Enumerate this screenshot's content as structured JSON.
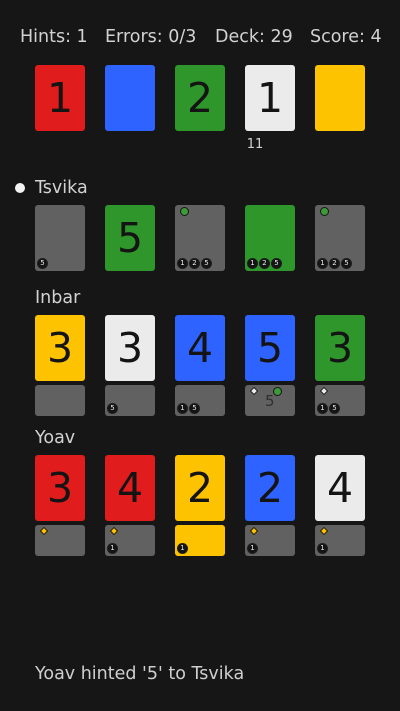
{
  "status": {
    "hints": "Hints: 1",
    "errors": "Errors: 0/3",
    "deck": "Deck: 29",
    "score": "Score: 4"
  },
  "colors": {
    "red": "#e01c1c",
    "blue": "#2f63ff",
    "green": "#2f962b",
    "white": "#ebebeb",
    "yellow": "#fdc200",
    "hint_bg": "#616161"
  },
  "fireworks": [
    {
      "color": "red",
      "value": "1"
    },
    {
      "color": "blue",
      "value": ""
    },
    {
      "color": "green",
      "value": "2"
    },
    {
      "color": "white",
      "value": "1"
    },
    {
      "color": "yellow",
      "value": ""
    }
  ],
  "fireworks_count": "11",
  "players": [
    {
      "name": "Tsvika",
      "active": true,
      "cards": [
        {
          "face": null,
          "color": null,
          "value": "",
          "hint_dots": [],
          "numbers": [
            "5"
          ],
          "center": ""
        },
        {
          "face": "visible",
          "color": "green",
          "value": "5",
          "hint_dots": [],
          "numbers": [],
          "center": ""
        },
        {
          "face": null,
          "color": null,
          "value": "",
          "hint_dots": [
            "green"
          ],
          "numbers": [
            "1",
            "2",
            "5"
          ],
          "center": ""
        },
        {
          "face": "tinted",
          "color": "green",
          "value": "",
          "hint_dots": [],
          "numbers": [
            "1",
            "2",
            "5"
          ],
          "center": ""
        },
        {
          "face": null,
          "color": null,
          "value": "",
          "hint_dots": [
            "green"
          ],
          "numbers": [
            "1",
            "2",
            "5"
          ],
          "center": ""
        }
      ]
    },
    {
      "name": "Inbar",
      "active": false,
      "cards": [
        {
          "color": "yellow",
          "value": "3",
          "hint_dots": [],
          "numbers": [],
          "center": ""
        },
        {
          "color": "white",
          "value": "3",
          "hint_dots": [],
          "numbers": [
            "5"
          ],
          "center": ""
        },
        {
          "color": "blue",
          "value": "4",
          "hint_dots": [],
          "numbers": [
            "1",
            "5"
          ],
          "center": ""
        },
        {
          "color": "blue",
          "value": "5",
          "hint_dots": [
            "white",
            "green"
          ],
          "numbers": [],
          "center": "5"
        },
        {
          "color": "green",
          "value": "3",
          "hint_dots": [
            "white"
          ],
          "numbers": [
            "1",
            "5"
          ],
          "center": ""
        }
      ]
    },
    {
      "name": "Yoav",
      "active": false,
      "cards": [
        {
          "color": "red",
          "value": "3",
          "hint_dots": [
            "yellow"
          ],
          "numbers": [],
          "center": ""
        },
        {
          "color": "red",
          "value": "4",
          "hint_dots": [
            "yellow"
          ],
          "numbers": [
            "1"
          ],
          "center": ""
        },
        {
          "color": "yellow",
          "value": "2",
          "hint_dots": [],
          "numbers": [
            "1"
          ],
          "center": "",
          "hint_color": "yellow"
        },
        {
          "color": "blue",
          "value": "2",
          "hint_dots": [
            "yellow"
          ],
          "numbers": [
            "1"
          ],
          "center": ""
        },
        {
          "color": "white",
          "value": "4",
          "hint_dots": [
            "yellow"
          ],
          "numbers": [
            "1"
          ],
          "center": ""
        }
      ]
    }
  ],
  "message": "Yoav hinted '5' to Tsvika"
}
